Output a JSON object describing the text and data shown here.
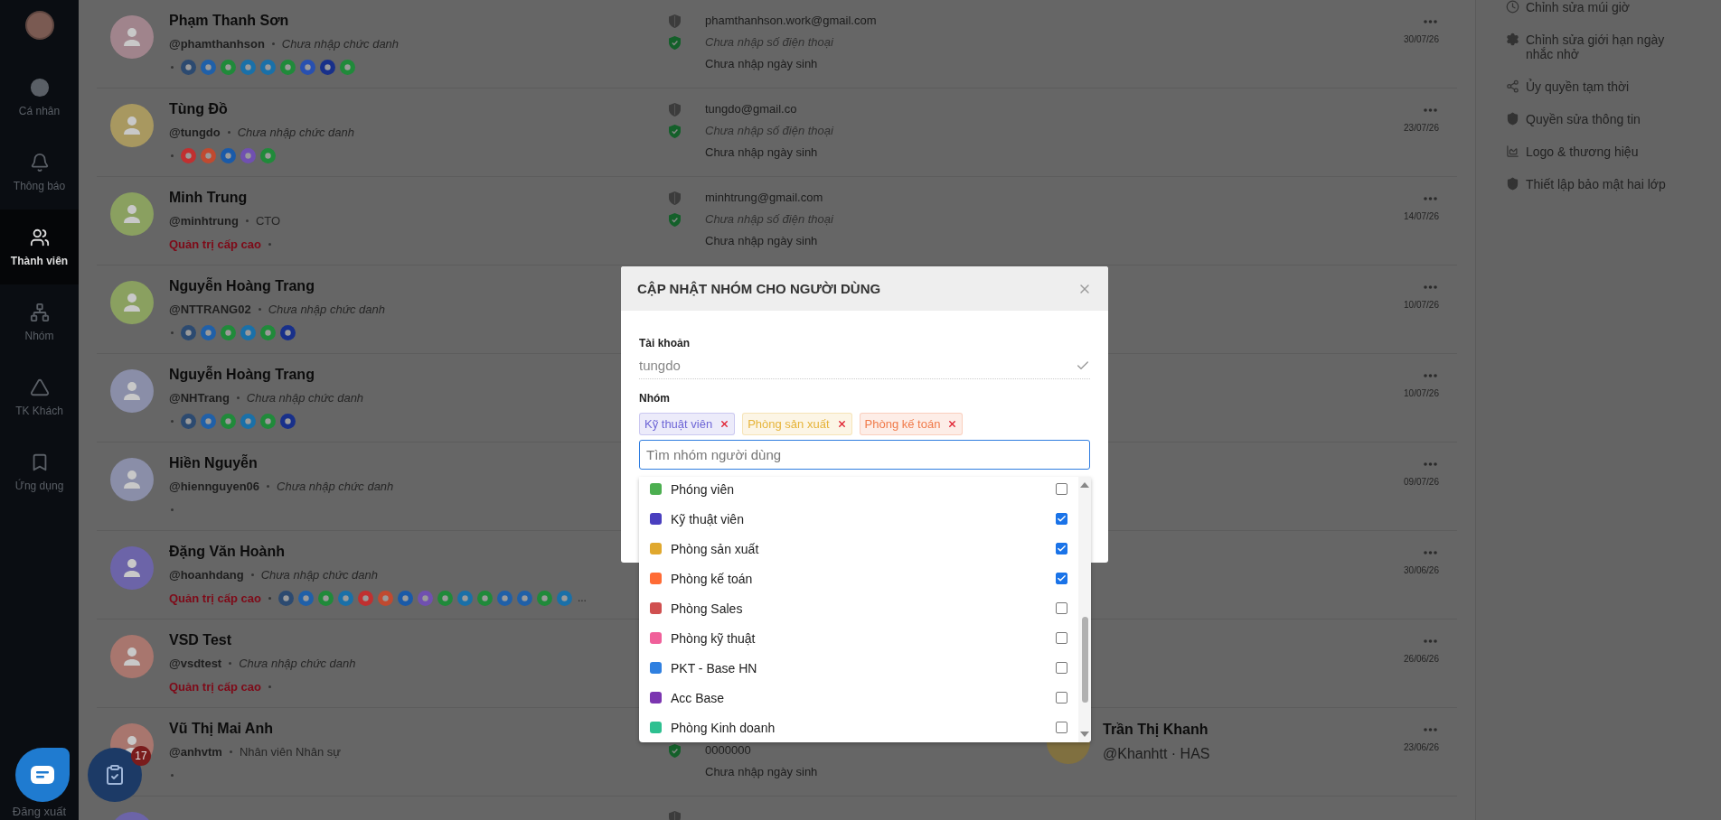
{
  "sidebar": {
    "items": [
      {
        "label": "Cá nhân",
        "selected": false
      },
      {
        "label": "Thông báo",
        "selected": false
      },
      {
        "label": "Thành viên",
        "selected": true
      },
      {
        "label": "Nhóm",
        "selected": false
      },
      {
        "label": "TK Khách",
        "selected": false
      },
      {
        "label": "Ứng dụng",
        "selected": false
      }
    ],
    "logout": "Đăng xuất"
  },
  "members": [
    {
      "name": "Phạm Thanh Sơn",
      "handle": "@phamthanhson",
      "title": {
        "text": "Chưa nhập chức danh",
        "missing": true
      },
      "color": "#a0848c",
      "apps": [
        {
          "color": "#2c4a70"
        },
        {
          "color": "#2060a8"
        },
        {
          "color": "#208a3a"
        },
        {
          "color": "#1a70a8"
        },
        {
          "color": "#1a70a8"
        },
        {
          "color": "#208a3a"
        },
        {
          "color": "#2850b0"
        },
        {
          "color": "#18308a"
        },
        {
          "color": "#208a3a"
        }
      ],
      "email": {
        "text": "phamthanhson.work@gmail.com",
        "verified": false
      },
      "phone": {
        "text": "Chưa nhập số điện thoại",
        "missing": true,
        "verified": true
      },
      "birthday": "Chưa nhập ngày sinh",
      "date": "30/07/26"
    },
    {
      "name": "Tùng Đồ",
      "handle": "@tungdo",
      "title": {
        "text": "Chưa nhập chức danh",
        "missing": true
      },
      "color": "#a89860",
      "apps": [
        {
          "color": "#c03030"
        },
        {
          "color": "#c04a30"
        },
        {
          "color": "#1a5aa8"
        },
        {
          "color": "#7050b0"
        },
        {
          "color": "#208a3a"
        }
      ],
      "email": {
        "text": "tungdo@gmail.co",
        "verified": false
      },
      "phone": {
        "text": "Chưa nhập số điện thoại",
        "missing": true,
        "verified": true
      },
      "birthday": "Chưa nhập ngày sinh",
      "date": "23/07/26"
    },
    {
      "name": "Minh Trung",
      "handle": "@minhtrung",
      "title": {
        "text": "CTO",
        "missing": false
      },
      "color": "#8aa060",
      "role": "Quản trị cấp cao",
      "email": {
        "text": "minhtrung@gmail.com",
        "verified": false
      },
      "phone": {
        "text": "Chưa nhập số điện thoại",
        "missing": true,
        "verified": true
      },
      "birthday": "Chưa nhập ngày sinh",
      "date": "14/07/26"
    },
    {
      "name": "Nguyễn Hoàng Trang",
      "handle": "@NTTRANG02",
      "title": {
        "text": "Chưa nhập chức danh",
        "missing": true
      },
      "color": "#8aa060",
      "apps": [
        {
          "color": "#2c4a70"
        },
        {
          "color": "#2060a8"
        },
        {
          "color": "#208a3a"
        },
        {
          "color": "#1a70a8"
        },
        {
          "color": "#208a3a"
        },
        {
          "color": "#18308a"
        }
      ],
      "date": "10/07/26"
    },
    {
      "name": "Nguyễn Hoàng Trang",
      "handle": "@NHTrang",
      "title": {
        "text": "Chưa nhập chức danh",
        "missing": true
      },
      "color": "#8a8ea8",
      "apps": [
        {
          "color": "#2c4a70"
        },
        {
          "color": "#2060a8"
        },
        {
          "color": "#208a3a"
        },
        {
          "color": "#1a70a8"
        },
        {
          "color": "#208a3a"
        },
        {
          "color": "#18308a"
        }
      ],
      "date": "10/07/26"
    },
    {
      "name": "Hiền Nguyễn",
      "handle": "@hiennguyen06",
      "title": {
        "text": "Chưa nhập chức danh",
        "missing": true
      },
      "color": "#8a8ea8",
      "date": "09/07/26"
    },
    {
      "name": "Đặng Văn Hoành",
      "handle": "@hoanhdang",
      "title": {
        "text": "Chưa nhập chức danh",
        "missing": true
      },
      "color": "#6c64a8",
      "role": "Quản trị cấp cao",
      "apps": [
        {
          "color": "#2c4a70"
        },
        {
          "color": "#2060a8"
        },
        {
          "color": "#208a3a"
        },
        {
          "color": "#1a70a8"
        },
        {
          "color": "#c03030"
        },
        {
          "color": "#c04a30"
        },
        {
          "color": "#1a5aa8"
        },
        {
          "color": "#7050b0"
        },
        {
          "color": "#208a3a"
        },
        {
          "color": "#1a70a8"
        },
        {
          "color": "#208a3a"
        },
        {
          "color": "#2060a8"
        },
        {
          "color": "#2060a8"
        },
        {
          "color": "#208a3a"
        },
        {
          "color": "#1a70a8"
        }
      ],
      "more": "...",
      "date": "30/06/26"
    },
    {
      "name": "VSD Test",
      "handle": "@vsdtest",
      "title": {
        "text": "Chưa nhập chức danh",
        "missing": true
      },
      "color": "#a8766e",
      "role": "Quản trị cấp cao",
      "date": "26/06/26"
    },
    {
      "name": "Vũ Thị Mai Anh",
      "handle": "@anhvtm",
      "title": {
        "text": "Nhân viên Nhân sự",
        "missing": false
      },
      "color": "#a8766e",
      "phone": {
        "text": "0000000",
        "missing": false,
        "verified": true
      },
      "birthday": "Chưa nhập ngày sinh",
      "manager": {
        "name": "Trần Thị Khanh",
        "handle": "@Khanhtt · HAS",
        "color": "#807040"
      },
      "date": "23/06/26"
    },
    {
      "color": "#6c64a8",
      "email": {
        "verified": false
      }
    }
  ],
  "settings": [
    {
      "label": "Chỉnh sửa múi giờ"
    },
    {
      "label": "Chỉnh sửa giới hạn ngày nhắc nhở"
    },
    {
      "label": "Ủy quyền tạm thời"
    },
    {
      "label": "Quyền sửa thông tin"
    },
    {
      "label": "Logo & thương hiệu"
    },
    {
      "label": "Thiết lập bảo mật hai lớp"
    }
  ],
  "modal": {
    "title": "CẬP NHẬT NHÓM CHO NGƯỜI DÙNG",
    "account_label": "Tài khoản",
    "account": "tungdo",
    "group_label": "Nhóm",
    "chips": [
      {
        "label": "Kỹ thuật viên",
        "color": "#6e66d6"
      },
      {
        "label": "Phòng sản xuất",
        "color": "#e6b43a"
      },
      {
        "label": "Phòng kế toán",
        "color": "#f07a4a"
      }
    ],
    "search": {
      "placeholder": "Tìm nhóm người dùng"
    },
    "groups": [
      {
        "label": "Phóng viên",
        "color": "#4caf50",
        "checked": false
      },
      {
        "label": "Kỹ thuật viên",
        "color": "#4a3fbf",
        "checked": true
      },
      {
        "label": "Phòng sản xuất",
        "color": "#e0a82e",
        "checked": true
      },
      {
        "label": "Phòng kế toán",
        "color": "#ff6b35",
        "checked": true
      },
      {
        "label": "Phòng Sales",
        "color": "#d05050",
        "checked": false
      },
      {
        "label": "Phòng kỹ thuật",
        "color": "#f0609a",
        "checked": false
      },
      {
        "label": "PKT - Base HN",
        "color": "#2f80e0",
        "checked": false
      },
      {
        "label": "Acc Base",
        "color": "#7b35b0",
        "checked": false
      },
      {
        "label": "Phòng Kinh doanh",
        "color": "#2ec090",
        "checked": false
      }
    ]
  },
  "task_badge": "17"
}
